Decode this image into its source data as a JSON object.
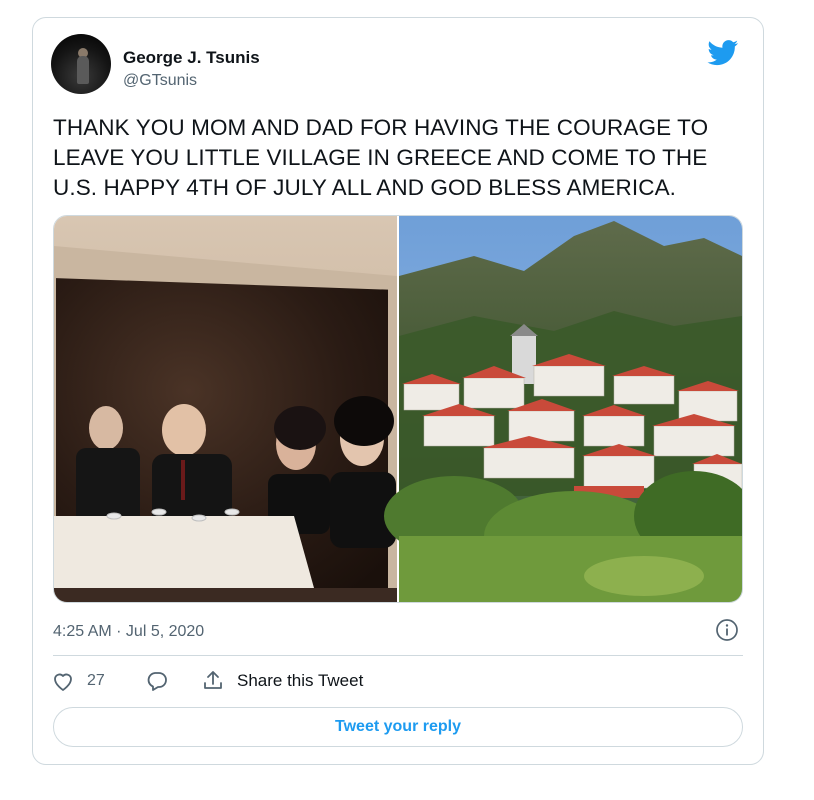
{
  "author": {
    "name": "George J. Tsunis",
    "handle": "@GTsunis",
    "avatar_icon": "profile-photo"
  },
  "tweet": {
    "text": "THANK YOU MOM AND DAD FOR HAVING THE COURAGE TO LEAVE YOU LITTLE VILLAGE IN GREECE AND COME TO THE U.S. HAPPY 4TH OF JULY ALL AND GOD BLESS AMERICA.",
    "timestamp": "4:25 AM · Jul 5, 2020"
  },
  "media": {
    "images": [
      {
        "icon": "vintage-family-photo"
      },
      {
        "icon": "mountain-village-photo"
      }
    ]
  },
  "actions": {
    "like_count": "27",
    "share_label": "Share this Tweet",
    "reply_button": "Tweet your reply"
  },
  "colors": {
    "brand": "#1d9bf0",
    "secondary_text": "#536471",
    "border": "#cfd9de"
  },
  "icons": {
    "brand": "twitter-bird-icon",
    "info": "info-icon",
    "like": "heart-icon",
    "reply": "reply-bubble-icon",
    "share": "share-icon"
  }
}
